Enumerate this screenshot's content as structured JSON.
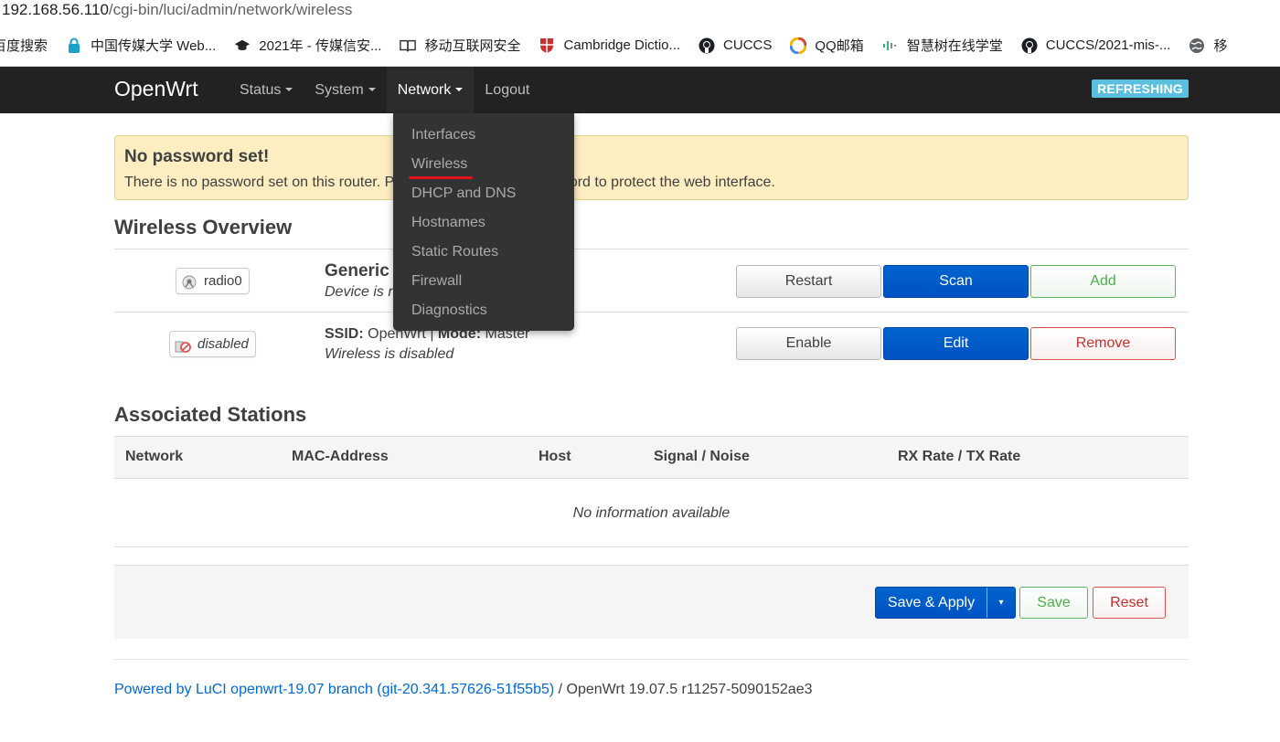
{
  "browser": {
    "url_host": "192.168.56.110",
    "url_path": "/cgi-bin/luci/admin/network/wireless",
    "bookmarks": [
      {
        "label": "百度搜索",
        "icon": "search-icon"
      },
      {
        "label": "中国传媒大学 Web...",
        "icon": "lock-icon"
      },
      {
        "label": "2021年 - 传媒信安...",
        "icon": "graduation-cap-icon"
      },
      {
        "label": "移动互联网安全",
        "icon": "book-icon"
      },
      {
        "label": "Cambridge Dictio...",
        "icon": "shield-crest-icon"
      },
      {
        "label": "CUCCS",
        "icon": "github-icon"
      },
      {
        "label": "QQ邮箱",
        "icon": "qq-mail-icon"
      },
      {
        "label": "智慧树在线学堂",
        "icon": "audio-bars-icon"
      },
      {
        "label": "CUCCS/2021-mis-...",
        "icon": "github-icon"
      },
      {
        "label": "移",
        "icon": "globe-icon"
      }
    ]
  },
  "nav": {
    "brand": "OpenWrt",
    "items": [
      {
        "label": "Status",
        "has_caret": true,
        "active": false
      },
      {
        "label": "System",
        "has_caret": true,
        "active": false
      },
      {
        "label": "Network",
        "has_caret": true,
        "active": true
      },
      {
        "label": "Logout",
        "has_caret": false,
        "active": false
      }
    ],
    "indicator": "REFRESHING",
    "network_menu": [
      "Interfaces",
      "Wireless",
      "DHCP and DNS",
      "Hostnames",
      "Static Routes",
      "Firewall",
      "Diagnostics"
    ]
  },
  "alert": {
    "title": "No password set!",
    "text_start": "There is no password set on this router. P",
    "text_end": "word to protect the web interface."
  },
  "wireless": {
    "title": "Wireless Overview",
    "radio": {
      "badge": "radio0",
      "name": "Generic",
      "status": "Device is n",
      "buttons": {
        "restart": "Restart",
        "scan": "Scan",
        "add": "Add"
      }
    },
    "network": {
      "badge": "disabled",
      "ssid_label": "SSID:",
      "ssid_value": "OpenWrt",
      "separator": "|",
      "mode_label": "Mode:",
      "mode_value": "Master",
      "status": "Wireless is disabled",
      "buttons": {
        "enable": "Enable",
        "edit": "Edit",
        "remove": "Remove"
      }
    }
  },
  "stations": {
    "title": "Associated Stations",
    "columns": [
      "Network",
      "MAC-Address",
      "Host",
      "Signal / Noise",
      "RX Rate / TX Rate"
    ],
    "empty": "No information available"
  },
  "actions": {
    "save_apply": "Save & Apply",
    "toggle": "▾",
    "save": "Save",
    "reset": "Reset"
  },
  "footer": {
    "link": "Powered by LuCI openwrt-19.07 branch (git-20.341.57626-51f55b5)",
    "text": " / OpenWrt 19.07.5 r11257-5090152ae3"
  }
}
